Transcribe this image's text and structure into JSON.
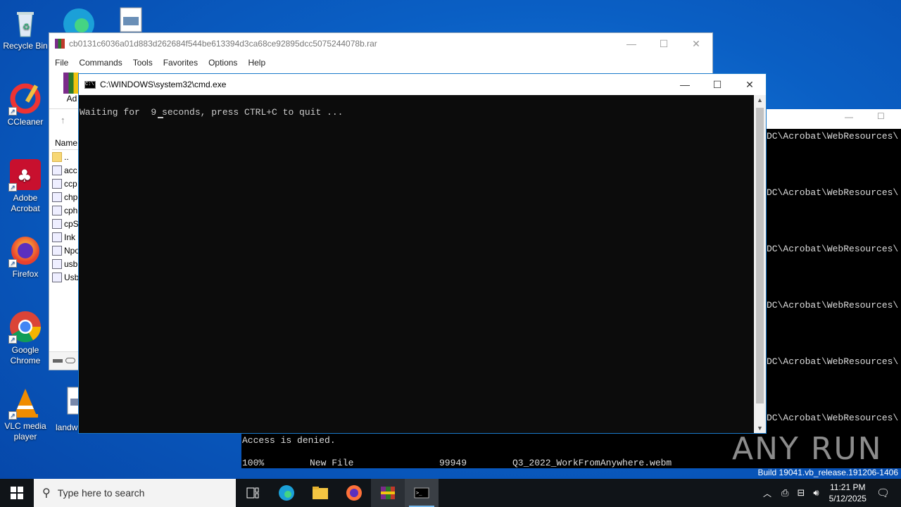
{
  "desktop_icons": [
    {
      "label": "Recycle Bin",
      "icon": "recycle-bin-icon"
    },
    {
      "label": "CCleaner",
      "icon": "ccleaner-icon"
    },
    {
      "label": "Adobe Acrobat",
      "icon": "adobe-acrobat-icon"
    },
    {
      "label": "Firefox",
      "icon": "firefox-icon"
    },
    {
      "label": "Google Chrome",
      "icon": "chrome-icon"
    },
    {
      "label": "VLC media player",
      "icon": "vlc-icon"
    },
    {
      "label": "landw",
      "icon": "file-icon"
    }
  ],
  "winrar": {
    "title": "cb0131c6036a01d883d262684f544be613394d3ca68ce92895dcc5075244078b.rar",
    "menu": [
      "File",
      "Commands",
      "Tools",
      "Favorites",
      "Options",
      "Help"
    ],
    "toolbar_label": "Ad",
    "list_header": "Name",
    "files": [
      "..",
      "acc",
      "ccp",
      "chp",
      "cph",
      "cpS",
      "Ink",
      "Npo",
      "usb",
      "Usb"
    ]
  },
  "cmd": {
    "title": "C:\\WINDOWS\\system32\\cmd.exe",
    "line": "Waiting for  9 seconds, press CTRL+C to quit ..."
  },
  "bg_terminal": {
    "line": "DC\\Acrobat\\WebResources\\"
  },
  "lower_terminal": {
    "line1": "Access is denied.",
    "line2_col1": "100%",
    "line2_col2": "New File",
    "line2_col3": "99949",
    "line2_col4": "Q3_2022_WorkFromAnywhere.webm"
  },
  "watermark": "ANY RUN",
  "build": "Build 19041.vb_release.191206-1406",
  "taskbar": {
    "search_placeholder": "Type here to search",
    "time": "11:21 PM",
    "date": "5/12/2025"
  },
  "colors": {
    "desktop": "#0a5fc4",
    "taskbar": "#101418",
    "accent": "#76b9ed"
  }
}
